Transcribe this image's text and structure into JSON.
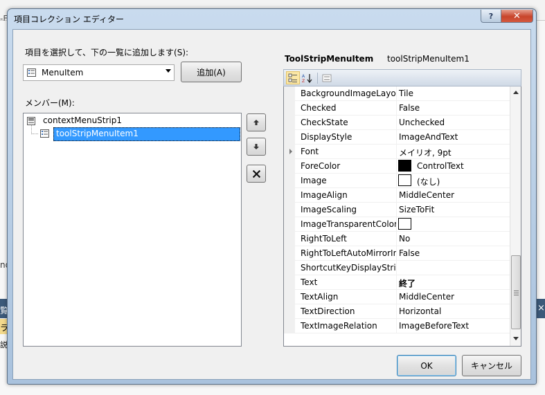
{
  "background": {
    "fragment_top": "-Fo",
    "fragment_mid": "nd",
    "fragment_a": "覧",
    "fragment_b": "ラ",
    "fragment_c": "説明",
    "close_glyph": "×"
  },
  "dialog": {
    "title": "項目コレクション エディター",
    "help_label": "?",
    "close_label": "✕"
  },
  "add_section": {
    "label": "項目を選択して、下の一覧に追加します(S):",
    "selected_type": "MenuItem",
    "add_button": "追加(A)"
  },
  "members": {
    "label": "メンバー(M):",
    "items": [
      "contextMenuStrip1",
      "toolStripMenuItem1"
    ]
  },
  "buttons": {
    "up_glyph": "↑",
    "down_glyph": "↓",
    "delete_glyph": "✕",
    "ok": "OK",
    "cancel": "キャンセル"
  },
  "property_grid": {
    "object_type": "ToolStripMenuItem",
    "object_name": "toolStripMenuItem1",
    "properties": [
      {
        "name": "BackgroundImageLayout",
        "value": "Tile"
      },
      {
        "name": "Checked",
        "value": "False"
      },
      {
        "name": "CheckState",
        "value": "Unchecked"
      },
      {
        "name": "DisplayStyle",
        "value": "ImageAndText"
      },
      {
        "name": "Font",
        "value": "メイリオ, 9pt"
      },
      {
        "name": "ForeColor",
        "value": "ControlText"
      },
      {
        "name": "Image",
        "value": "(なし)"
      },
      {
        "name": "ImageAlign",
        "value": "MiddleCenter"
      },
      {
        "name": "ImageScaling",
        "value": "SizeToFit"
      },
      {
        "name": "ImageTransparentColor",
        "value": ""
      },
      {
        "name": "RightToLeft",
        "value": "No"
      },
      {
        "name": "RightToLeftAutoMirrorImage",
        "value": "False"
      },
      {
        "name": "ShortcutKeyDisplayString",
        "value": ""
      },
      {
        "name": "Text",
        "value": "終了"
      },
      {
        "name": "TextAlign",
        "value": "MiddleCenter"
      },
      {
        "name": "TextDirection",
        "value": "Horizontal"
      },
      {
        "name": "TextImageRelation",
        "value": "ImageBeforeText"
      }
    ]
  },
  "colors": {
    "selection": "#3399ff",
    "forecolor_swatch": "#000000",
    "white_swatch": "#ffffff"
  }
}
